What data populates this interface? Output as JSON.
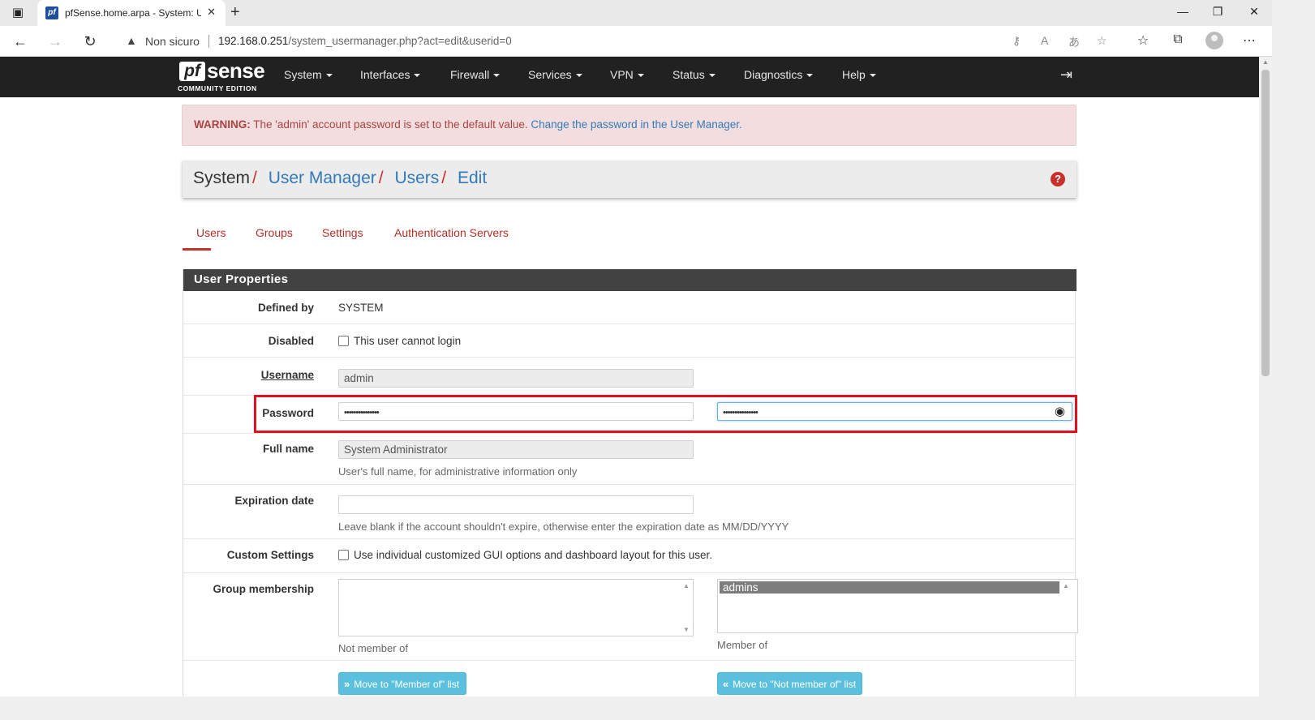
{
  "browser": {
    "tab_title": "pfSense.home.arpa - System: User Manager: Users: Edit",
    "tab_favicon": "pf",
    "security_label": "Non sicuro",
    "url_host": "192.168.0.251",
    "url_path": "/system_usermanager.php?act=edit&userid=0"
  },
  "nav": {
    "logo_mark": "pf",
    "logo_word": "sense",
    "logo_edition": "COMMUNITY EDITION",
    "menu": [
      "System",
      "Interfaces",
      "Firewall",
      "Services",
      "VPN",
      "Status",
      "Diagnostics",
      "Help"
    ]
  },
  "alert": {
    "prefix": "WARNING:",
    "message": " The 'admin' account password is set to the default value. ",
    "link": "Change the password in the User Manager."
  },
  "breadcrumb": {
    "root": "System",
    "items": [
      "User Manager",
      "Users",
      "Edit"
    ],
    "separator": "/"
  },
  "tabs": [
    "Users",
    "Groups",
    "Settings",
    "Authentication Servers"
  ],
  "active_tab": "Users",
  "panel": {
    "title": "User Properties",
    "defined_by": {
      "label": "Defined by",
      "value": "SYSTEM"
    },
    "disabled": {
      "label": "Disabled",
      "checkbox_label": "This user cannot login",
      "checked": false
    },
    "username": {
      "label": "Username",
      "value": "admin"
    },
    "password": {
      "label": "Password",
      "value": "•••••••••••••••",
      "confirm": "•••••••••••••••"
    },
    "full_name": {
      "label": "Full name",
      "value": "System Administrator",
      "help": "User's full name, for administrative information only"
    },
    "expiration": {
      "label": "Expiration date",
      "value": "",
      "help": "Leave blank if the account shouldn't expire, otherwise enter the expiration date as MM/DD/YYYY"
    },
    "custom_settings": {
      "label": "Custom Settings",
      "checkbox_label": "Use individual customized GUI options and dashboard layout for this user.",
      "checked": false
    },
    "group_membership": {
      "label": "Group membership",
      "not_member_items": [],
      "member_items": [
        "admins"
      ],
      "not_member_caption": "Not member of",
      "member_caption": "Member of",
      "move_to_member": "Move to \"Member of\" list",
      "move_to_not_member": "Move to \"Not member of\" list"
    }
  },
  "colors": {
    "navbar": "#212121",
    "accent_red": "#c9302c",
    "link_blue": "#337ab7",
    "info_button": "#5bc0de",
    "highlight_box": "#e0121f"
  }
}
